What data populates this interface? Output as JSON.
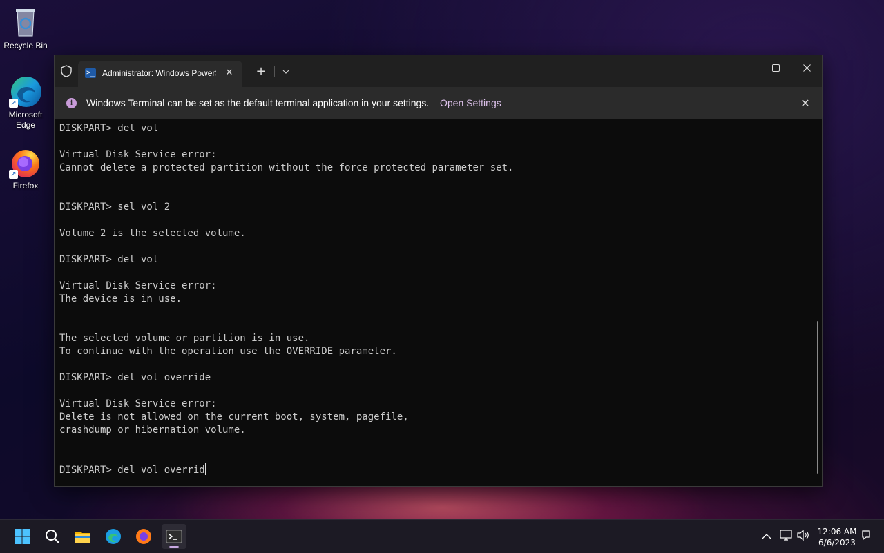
{
  "desktop": {
    "icons": [
      {
        "label": "Recycle Bin"
      },
      {
        "label": "Microsoft Edge"
      },
      {
        "label": "Firefox"
      }
    ]
  },
  "window": {
    "tab_title": "Administrator: Windows PowerShell",
    "tab_close_glyph": "✕",
    "new_tab_glyph": "+",
    "dropdown_glyph": "⌄",
    "min_glyph": "—",
    "max_glyph": "☐",
    "close_glyph": "✕"
  },
  "infobar": {
    "icon_glyph": "i",
    "message": "Windows Terminal can be set as the default terminal application in your settings.",
    "link": "Open Settings",
    "close_glyph": "✕"
  },
  "console": {
    "lines": [
      "DISKPART> del vol",
      "",
      "Virtual Disk Service error:",
      "Cannot delete a protected partition without the force protected parameter set.",
      "",
      "",
      "DISKPART> sel vol 2",
      "",
      "Volume 2 is the selected volume.",
      "",
      "DISKPART> del vol",
      "",
      "Virtual Disk Service error:",
      "The device is in use.",
      "",
      "",
      "The selected volume or partition is in use.",
      "To continue with the operation use the OVERRIDE parameter.",
      "",
      "DISKPART> del vol override",
      "",
      "Virtual Disk Service error:",
      "Delete is not allowed on the current boot, system, pagefile,",
      "crashdump or hibernation volume.",
      "",
      "",
      "DISKPART> del vol overrid"
    ]
  },
  "taskbar": {
    "apps": [
      "start-icon",
      "search-icon",
      "file-explorer-icon",
      "edge-icon",
      "firefox-icon",
      "terminal-icon"
    ],
    "tray_chevron": "^",
    "time": "12:06 AM",
    "date": "6/6/2023"
  }
}
